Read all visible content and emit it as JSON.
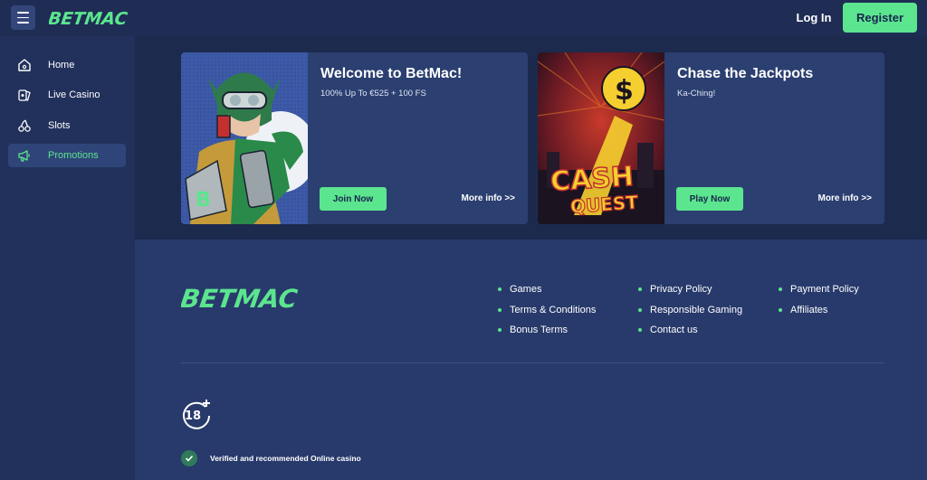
{
  "header": {
    "logo_text": "BETMAC",
    "login_label": "Log In",
    "register_label": "Register"
  },
  "sidebar": {
    "items": [
      {
        "label": "Home",
        "icon": "home-icon"
      },
      {
        "label": "Live Casino",
        "icon": "cards-icon"
      },
      {
        "label": "Slots",
        "icon": "cherries-icon"
      },
      {
        "label": "Promotions",
        "icon": "megaphone-icon",
        "active": true
      }
    ]
  },
  "promos": [
    {
      "title": "Welcome to BetMac!",
      "subtitle": "100% Up To €525 + 100 FS",
      "cta": "Join Now",
      "more": "More info >>"
    },
    {
      "title": "Chase the Jackpots",
      "subtitle": "Ka-Ching!",
      "cta": "Play Now",
      "more": "More info >>",
      "art_text": [
        "CASH",
        "QUEST"
      ]
    }
  ],
  "footer": {
    "logo_text": "BETMAC",
    "links_col1": [
      "Games",
      "Terms & Conditions",
      "Bonus Terms"
    ],
    "links_col2": [
      "Privacy Policy",
      "Responsible Gaming",
      "Contact us"
    ],
    "links_col3": [
      "Payment Policy",
      "Affiliates"
    ],
    "age_badge": "18+",
    "verified_text": "Verified and recommended Online casino"
  },
  "colors": {
    "accent": "#5ce58f",
    "page_bg": "#283a6b",
    "header_bg": "#1f2d55",
    "card_bg": "#2b3f70"
  }
}
